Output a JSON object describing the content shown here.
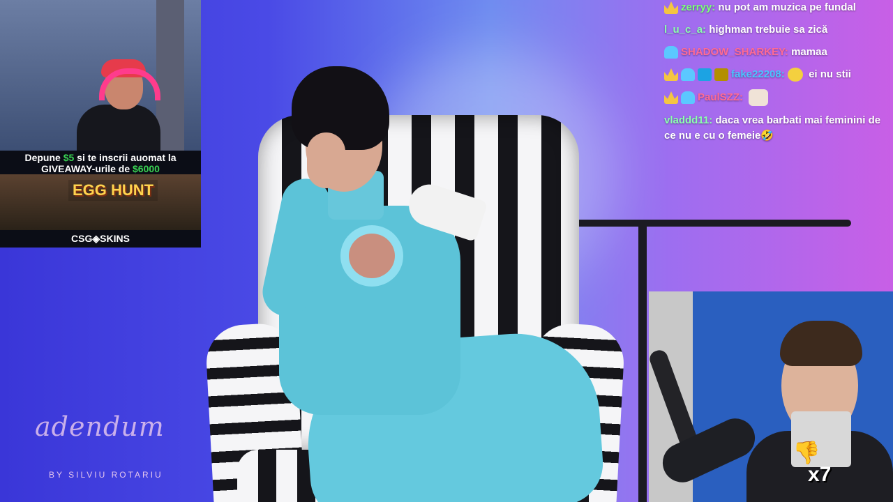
{
  "promo": {
    "line1_pre": "Depune ",
    "line1_amount": "$5",
    "line1_post": " si te inscrii auomat la",
    "line2_pre": "GIVEAWAY-urile de ",
    "line2_amount": "$6000",
    "art_title": "EGG HUNT",
    "brand": "CSG◈SKINS"
  },
  "chat": {
    "messages": [
      {
        "user": "zerryy:",
        "text": "nu pot am muzica pe fundal"
      },
      {
        "user": "l_u_c_a:",
        "text": "highman trebuie sa zică"
      },
      {
        "user": "SHADOW_SHARKEY:",
        "text": "mamaa"
      },
      {
        "user": "fake22208:",
        "text": "ei nu stii"
      },
      {
        "user": "PaulSZZ:",
        "text": ""
      },
      {
        "user": "vladdd11:",
        "text": "daca vrea barbati mai feminini de ce nu e cu o femeie🤣"
      }
    ]
  },
  "emote": {
    "count": "x7"
  },
  "logo": {
    "script": "adendum",
    "subtitle": "BY SILVIU ROTARIU"
  }
}
